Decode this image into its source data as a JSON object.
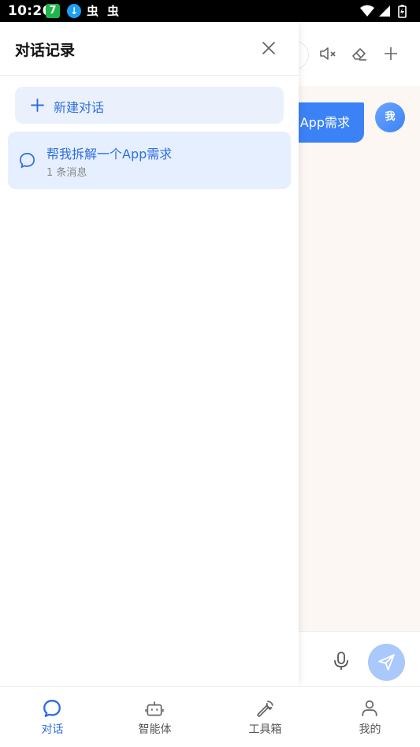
{
  "status_bar": {
    "time": "10:26",
    "app_badge": "7",
    "download_glyph": "↓",
    "bug_glyph": "虫"
  },
  "chat": {
    "user_message": "App需求",
    "avatar_label": "我"
  },
  "drawer": {
    "title": "对话记录",
    "new_chat_label": "新建对话",
    "conversations": [
      {
        "title": "帮我拆解一个App需求",
        "subtitle": "1 条消息"
      }
    ]
  },
  "bottom_nav": {
    "items": [
      {
        "label": "对话",
        "icon": "chat-bubble-icon",
        "active": true
      },
      {
        "label": "智能体",
        "icon": "robot-icon",
        "active": false
      },
      {
        "label": "工具箱",
        "icon": "wrench-icon",
        "active": false
      },
      {
        "label": "我的",
        "icon": "person-icon",
        "active": false
      }
    ]
  },
  "colors": {
    "accent": "#2f6fe0",
    "bubble": "#3b82f6",
    "send_disabled": "#a9c8fb",
    "highlight_bg": "#e6efff"
  }
}
